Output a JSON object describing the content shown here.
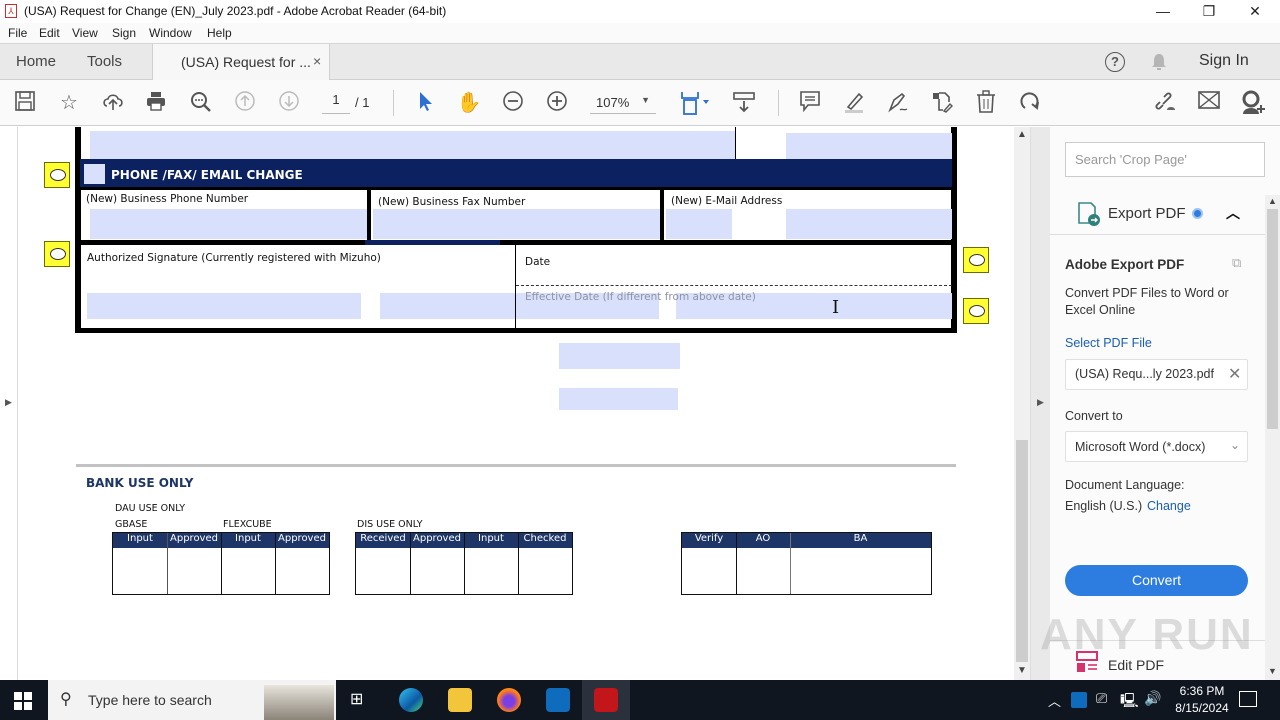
{
  "window": {
    "title": "(USA) Request for Change (EN)_July 2023.pdf - Adobe Acrobat Reader (64-bit)",
    "controls": {
      "minimize": "—",
      "restore": "❐",
      "close": "✕"
    }
  },
  "menu": [
    "File",
    "Edit",
    "View",
    "Sign",
    "Window",
    "Help"
  ],
  "tabs": {
    "home": "Home",
    "tools": "Tools",
    "document": "(USA) Request for ...",
    "close": "×",
    "sign_in": "Sign In"
  },
  "toolbar": {
    "page_current": "1",
    "page_total": "/ 1",
    "zoom": "107%",
    "icons": [
      "save-icon",
      "bookmark-star-icon",
      "upload-cloud-icon",
      "print-icon",
      "zoom-search-icon",
      "page-up-icon",
      "page-down-icon",
      "select-cursor-icon",
      "hand-icon",
      "zoom-out-icon",
      "zoom-in-icon",
      "fit-page-icon",
      "scroll-mode-icon",
      "comment-icon",
      "highlight-icon",
      "sign-icon",
      "edit-pages-icon",
      "delete-icon",
      "rotate-icon",
      "share-link-icon",
      "email-icon",
      "add-user-icon"
    ]
  },
  "pdf": {
    "section_title": "PHONE /FAX/ EMAIL CHANGE",
    "phone_label": "(New) Business Phone Number",
    "fax_label": "(New) Business Fax Number",
    "email_label": "(New) E-Mail Address",
    "signature_label": "Authorized Signature (Currently registered with Mizuho)",
    "date_label": "Date",
    "effective_date_label": "Effective Date (If different from above date)",
    "bank_use_only": "BANK USE ONLY",
    "dau_use_only": "DAU USE ONLY",
    "gbase": "GBASE",
    "flexcube": "FLEXCUBE",
    "dis_use_only": "DIS USE ONLY",
    "table1_headers": [
      "Input",
      "Approved",
      "Input",
      "Approved"
    ],
    "table2_headers": [
      "Received",
      "Approved",
      "Input",
      "Checked"
    ],
    "table3_headers": [
      "Verify",
      "AO",
      "BA"
    ]
  },
  "right_pane": {
    "search_placeholder": "Search 'Crop Page'",
    "export_title": "Export PDF",
    "adobe_export_title": "Adobe Export PDF",
    "description": "Convert PDF Files to Word or Excel Online",
    "select_file_label": "Select PDF File",
    "file_name": "(USA) Requ...ly 2023.pdf",
    "convert_to_label": "Convert to",
    "convert_to_value": "Microsoft Word (*.docx)",
    "doc_language_label": "Document Language:",
    "doc_language_value": "English (U.S.)",
    "change_link": "Change",
    "convert_button": "Convert",
    "edit_pdf": "Edit PDF"
  },
  "taskbar": {
    "search_placeholder": "Type here to search",
    "time": "6:36 PM",
    "date": "8/15/2024"
  },
  "watermark": "ANY RUN",
  "colors": {
    "accent_blue": "#2d7ce0",
    "form_navy": "#0b2160",
    "field_fill": "#d9e0fb",
    "note_yellow": "#ffff33"
  }
}
